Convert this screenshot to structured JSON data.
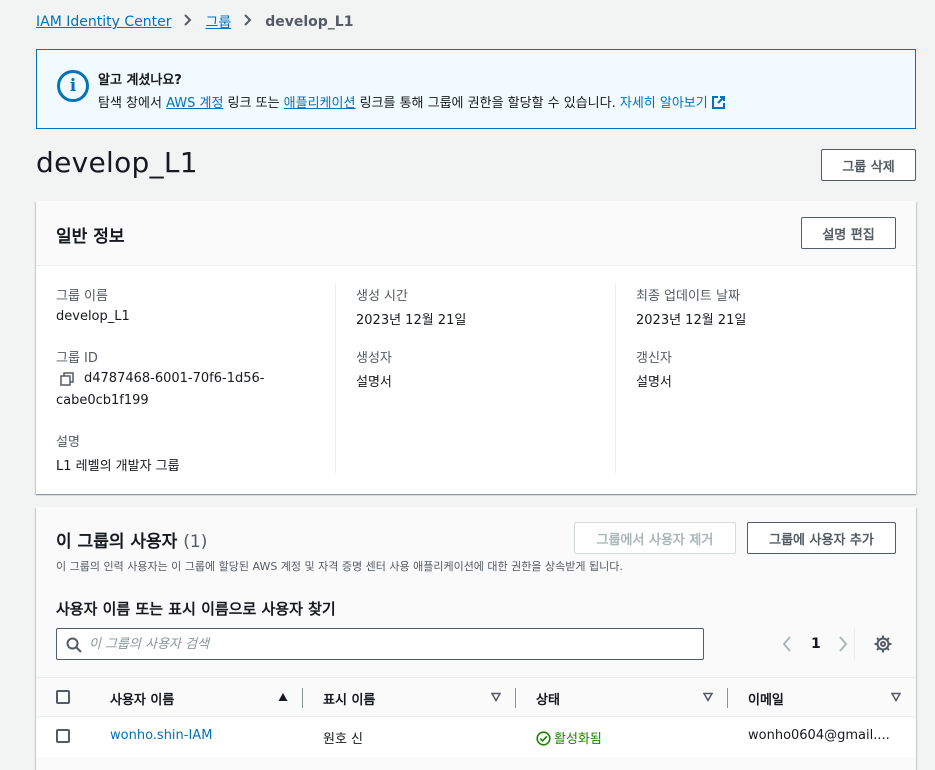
{
  "breadcrumb": {
    "root": "IAM Identity Center",
    "groups": "그룹",
    "current": "develop_L1"
  },
  "banner": {
    "title": "알고 계셨나요?",
    "text_prefix": "탐색 창에서 ",
    "link_aws_account": "AWS 계정",
    "text_mid1": " 링크 또는 ",
    "link_apps": "애플리케이션",
    "text_mid2": " 링크를 통해 그룹에 권한을 할당할 수 있습니다. ",
    "learn_more": "자세히 알아보기",
    "icon": "info-icon"
  },
  "page": {
    "title": "develop_L1",
    "delete_button": "그룹 삭제"
  },
  "general": {
    "title": "일반 정보",
    "edit_button": "설명 편집",
    "group_name_label": "그룹 이름",
    "group_name": "develop_L1",
    "group_id_label": "그룹 ID",
    "group_id_line1": "d4787468-6001-70f6-1d56-",
    "group_id_line2": "cabe0cb1f199",
    "description_label": "설명",
    "description": "L1 레벨의 개발자 그룹",
    "created_label": "생성 시간",
    "created": "2023년 12월 21일",
    "creator_label": "생성자",
    "creator": "설명서",
    "updated_label": "최종 업데이트 날짜",
    "updated": "2023년 12월 21일",
    "updater_label": "갱신자",
    "updater": "설명서"
  },
  "users": {
    "title": "이 그룹의 사용자",
    "count": "(1)",
    "remove_button": "그룹에서 사용자 제거",
    "add_button": "그룹에 사용자 추가",
    "description": "이 그룹의 인력 사용자는 이 그룹에 할당된 AWS 계정 및 자격 증명 센터 사용 애플리케이션에 대한 권한을 상속받게 됩니다.",
    "search_heading": "사용자 이름 또는 표시 이름으로 사용자 찾기",
    "search_placeholder": "이 그룹의 사용자 검색",
    "page_number": "1",
    "columns": [
      "사용자 이름",
      "표시 이름",
      "상태",
      "이메일"
    ],
    "rows": [
      {
        "username": "wonho.shin-IAM",
        "display_name": "원호 신",
        "status": "활성화됨",
        "email": "wonho0604@gmail...."
      }
    ]
  },
  "colors": {
    "link": "#0073bb",
    "success": "#1d8102",
    "banner_bg": "#f1faff"
  }
}
